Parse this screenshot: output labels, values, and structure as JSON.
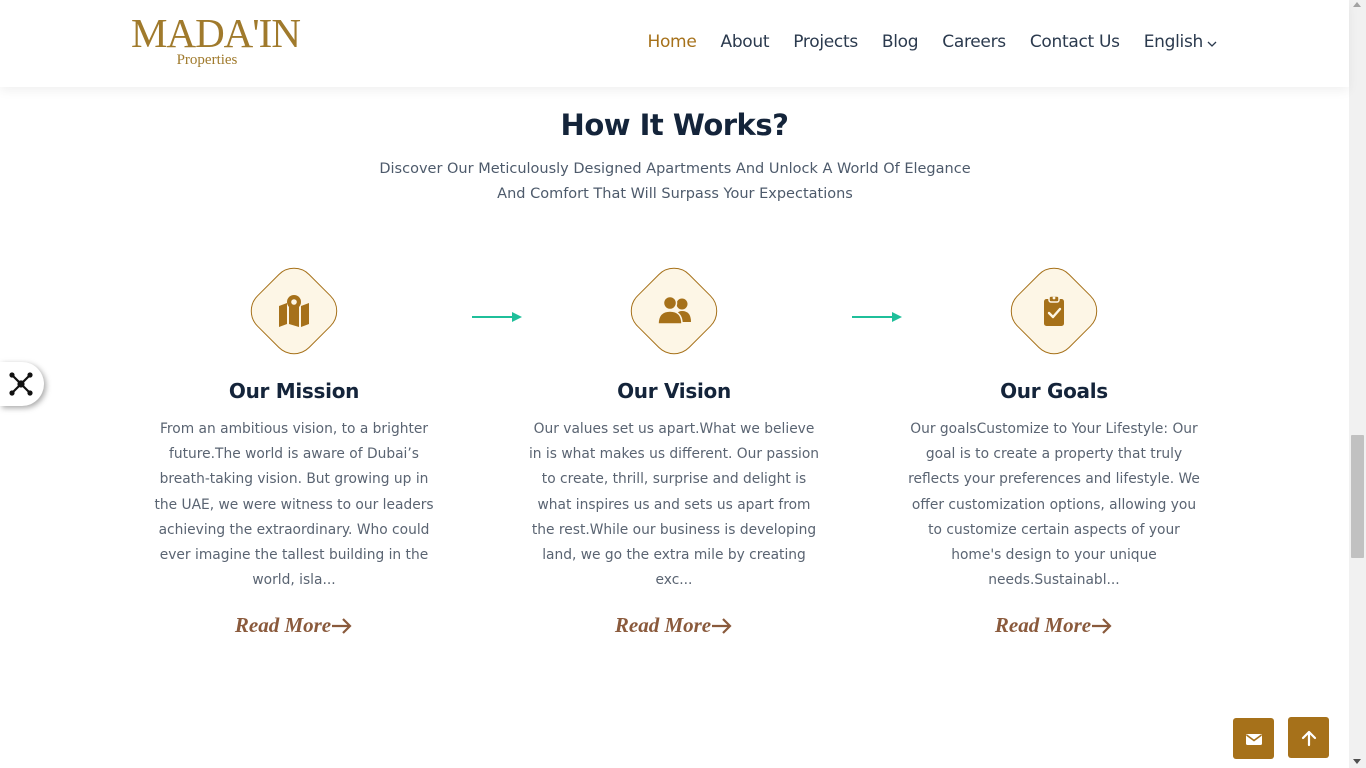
{
  "brand": {
    "name": "MADA'IN",
    "tagline": "Properties",
    "color": "#a6711a"
  },
  "nav": {
    "items": [
      {
        "label": "Home",
        "active": true
      },
      {
        "label": "About"
      },
      {
        "label": "Projects"
      },
      {
        "label": "Blog"
      },
      {
        "label": "Careers"
      },
      {
        "label": "Contact Us"
      }
    ],
    "language": "English"
  },
  "section": {
    "title": "How It Works?",
    "subtitle": "Discover Our Meticulously Designed Apartments And Unlock A World Of Elegance And Comfort That Will Surpass Your Expectations"
  },
  "cards": [
    {
      "icon": "map-marker-icon",
      "title": "Our Mission",
      "text": "From an ambitious vision, to a brighter future.The world is aware of Dubai’s breath-taking vision. But growing up in the UAE, we were witness to our leaders achieving the extraordinary. Who could ever imagine the tallest building in the world, isla...",
      "link": "Read More"
    },
    {
      "icon": "users-icon",
      "title": "Our Vision",
      "text": "Our values set us apart.What we believe in is what makes us different. Our passion to create, thrill, surprise and delight is what inspires us and sets us apart from the rest.While our business is developing land, we go the extra mile by creating exc...",
      "link": "Read More"
    },
    {
      "icon": "clipboard-check-icon",
      "title": "Our Goals",
      "text": "Our goalsCustomize to Your Lifestyle: Our goal is to create a property that truly reflects your preferences and lifestyle. We offer customization options, allowing you to customize certain aspects of your home's design to your unique needs.Sustainabl...",
      "link": "Read More"
    }
  ],
  "colors": {
    "accent": "#a6711a",
    "arrow": "#1fbf9a",
    "heading": "#14243a",
    "link": "#8a5a3c"
  }
}
